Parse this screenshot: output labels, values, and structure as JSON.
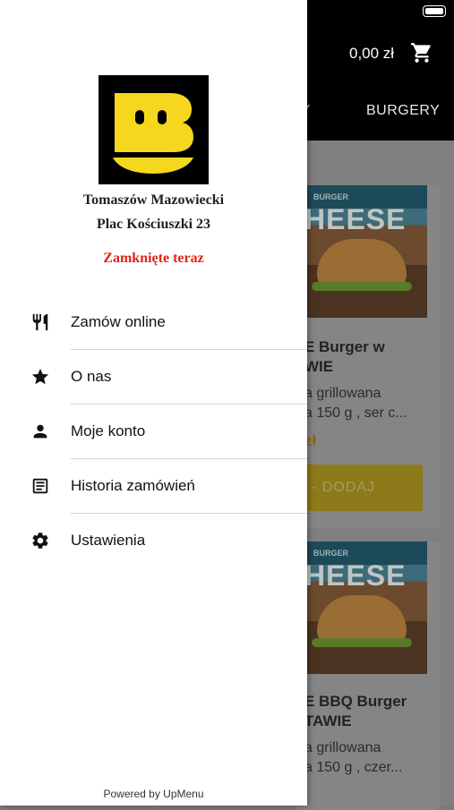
{
  "status_bar": {
    "battery": "full"
  },
  "header": {
    "cart_total": "0,00 zł",
    "cart_icon": "cart-icon",
    "tabs": [
      {
        "label": "WY"
      },
      {
        "label": "BURGERY"
      }
    ]
  },
  "products": [
    {
      "image_banner": "BURGER",
      "image_word": "HEESE",
      "title": "E Burger w\nWIE",
      "description": "a grillowana\na 150 g , ser c...",
      "price": "zł",
      "add_label": "- DODAJ"
    },
    {
      "image_banner": "BURGER",
      "image_word": "HEESE",
      "title": "E BBQ Burger\nTAWIE",
      "description": "a grillowana\na 150 g , czer..."
    }
  ],
  "drawer": {
    "logo_icon": "restaurant-logo",
    "city": "Tomaszów Mazowiecki",
    "address": "Plac Kościuszki 23",
    "status": "Zamknięte teraz",
    "status_color": "#e0241b",
    "menu": [
      {
        "label": "Zamów online",
        "icon": "fork-knife-icon"
      },
      {
        "label": "O nas",
        "icon": "star-icon"
      },
      {
        "label": "Moje konto",
        "icon": "person-icon"
      },
      {
        "label": "Historia zamówień",
        "icon": "receipt-icon"
      },
      {
        "label": "Ustawienia",
        "icon": "gear-icon"
      }
    ],
    "powered_by": "Powered by UpMenu"
  },
  "colors": {
    "accent": "#f2d21b",
    "header_bg": "#000000"
  }
}
